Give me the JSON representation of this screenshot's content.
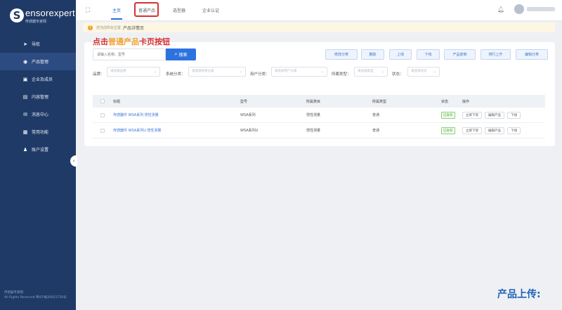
{
  "sidebar": {
    "logo_mark": "S",
    "logo_name": "ensorexpert",
    "logo_sub": "传感器专家网",
    "items": [
      {
        "label": "导航",
        "icon": "compass-icon",
        "active": false
      },
      {
        "label": "产品管理",
        "icon": "product-icon",
        "active": true
      },
      {
        "label": "企业及成员",
        "icon": "company-icon",
        "active": false
      },
      {
        "label": "内容管理",
        "icon": "content-icon",
        "active": false
      },
      {
        "label": "消息中心",
        "icon": "message-icon",
        "active": false
      },
      {
        "label": "常用功能",
        "icon": "tools-icon",
        "active": false
      },
      {
        "label": "账户设置",
        "icon": "user-icon",
        "active": false
      }
    ],
    "footer_line1": "传感器专家网",
    "footer_line2": "All Rights Reserved 粤ICP备20021750号"
  },
  "topbar": {
    "tabs": [
      {
        "label": "主页",
        "active": true
      },
      {
        "label": "普通产品",
        "active": false
      },
      {
        "label": "选型器",
        "active": false
      },
      {
        "label": "企业认证",
        "active": false
      }
    ]
  },
  "notice": {
    "prefix": "您当前所处位置",
    "current": "产品详情页"
  },
  "annotations": {
    "instruction_prefix": "点击",
    "instruction_highlight": "普通产品",
    "instruction_suffix": "卡页按钮",
    "footer_caption": "产品上传:"
  },
  "toolbar": {
    "search_placeholder": "请输入名称、型号",
    "search_label": "搜索",
    "actions": [
      "修改分类",
      "删除",
      "上线",
      "下线",
      "产品复制",
      "排行上升",
      "编辑分类"
    ]
  },
  "filters": [
    {
      "label": "品牌：",
      "placeholder": "请选择品牌"
    },
    {
      "label": "系统分类：",
      "placeholder": "请选择系统分类"
    },
    {
      "label": "用户分类：",
      "placeholder": "请选择用户分类"
    },
    {
      "label": "所属类型：",
      "placeholder": "请选择类型"
    },
    {
      "label": "状态：",
      "placeholder": "请选择状态"
    }
  ],
  "table": {
    "columns": [
      "标题",
      "型号",
      "所属类目",
      "所属类型",
      "状态",
      "操作"
    ],
    "rows": [
      {
        "title": "传感器件 WSA系列 惯性测量",
        "model": "WSA系列",
        "category": "惯性测量",
        "type": "普通",
        "status": "已发布",
        "ops": [
          "立即下架",
          "编辑产品",
          "下线"
        ]
      },
      {
        "title": "传感器件 WSA系列U 惯性测量",
        "model": "WSA系列U",
        "category": "惯性测量",
        "type": "普通",
        "status": "已发布",
        "ops": [
          "立即下架",
          "编辑产品",
          "下线"
        ]
      }
    ]
  },
  "colors": {
    "sidebar_bg": "#1f3a66",
    "accent": "#2d73e0",
    "highlight_red": "#d63131",
    "annotation_orange": "#f0a22a",
    "annotation_blue": "#1f63b8",
    "status_green": "#4fae3a"
  }
}
